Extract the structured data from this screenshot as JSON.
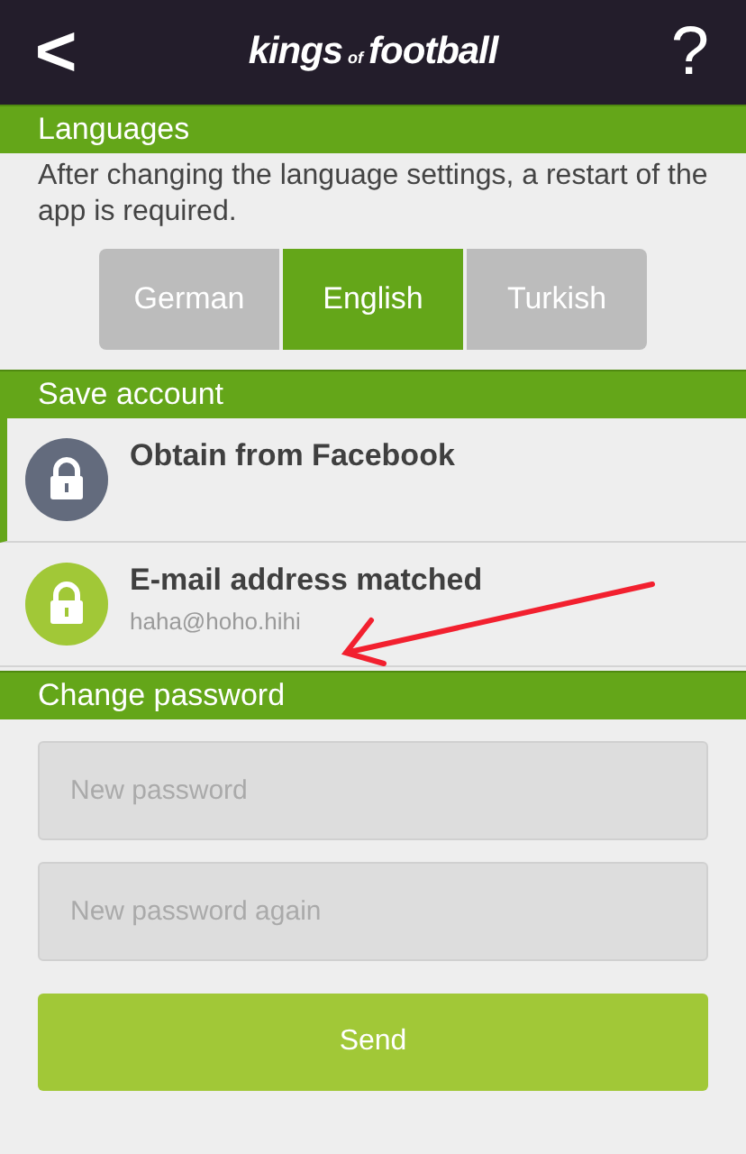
{
  "header": {
    "back": "<",
    "logo": [
      "kings",
      "of",
      "football"
    ],
    "help": "?"
  },
  "languages": {
    "title": "Languages",
    "note": "After changing the language settings, a restart of the app is required.",
    "options": [
      {
        "label": "German",
        "selected": false
      },
      {
        "label": "English",
        "selected": true
      },
      {
        "label": "Turkish",
        "selected": false
      }
    ]
  },
  "save_account": {
    "title": "Save account",
    "items": [
      {
        "title": "Obtain from Facebook",
        "linked": false,
        "selected": true
      },
      {
        "title": "E-mail address matched",
        "subtitle": "haha@hoho.hihi",
        "linked": true,
        "selected": false
      }
    ]
  },
  "change_password": {
    "title": "Change password",
    "fields": [
      {
        "placeholder": "New password"
      },
      {
        "placeholder": "New password again"
      }
    ],
    "button": "Send"
  }
}
